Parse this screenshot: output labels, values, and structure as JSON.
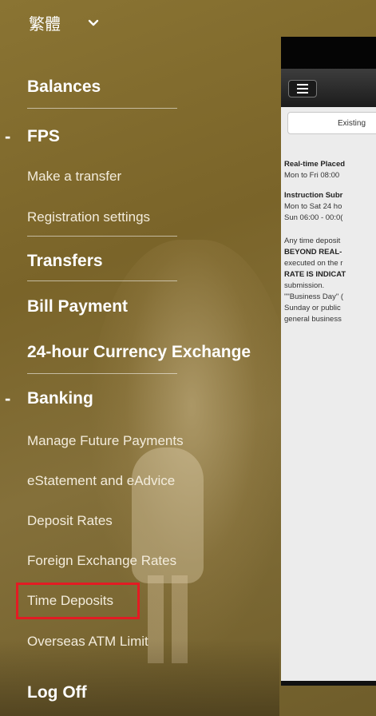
{
  "language": {
    "label": "繁體",
    "icon": "chevron-down-icon"
  },
  "menu": {
    "balances": "Balances",
    "fps": {
      "marker": "-",
      "label": "FPS"
    },
    "make_transfer": "Make a transfer",
    "registration_settings": "Registration settings",
    "transfers": "Transfers",
    "bill_payment": "Bill Payment",
    "currency_exchange": "24-hour Currency Exchange",
    "banking": {
      "marker": "-",
      "label": "Banking"
    },
    "manage_future_payments": "Manage Future Payments",
    "estatement": "eStatement and eAdvice",
    "deposit_rates": "Deposit Rates",
    "fx_rates": "Foreign Exchange Rates",
    "time_deposits": "Time Deposits",
    "overseas_atm": "Overseas ATM Limit",
    "log_off": "Log Off"
  },
  "highlight_color": "#e31b23",
  "phone": {
    "tab_label": "Existing",
    "lines": [
      "Real-time Placed",
      "Mon to Fri 08:00",
      "Instruction Subr",
      "Mon to Sat 24 ho",
      "Sun 06:00 - 00:0(",
      "Any time deposit",
      "BEYOND REAL-",
      "executed on the r",
      "RATE IS INDICAT",
      "submission.",
      "\"\"Business Day\" (",
      "Sunday or public",
      "general business"
    ]
  }
}
